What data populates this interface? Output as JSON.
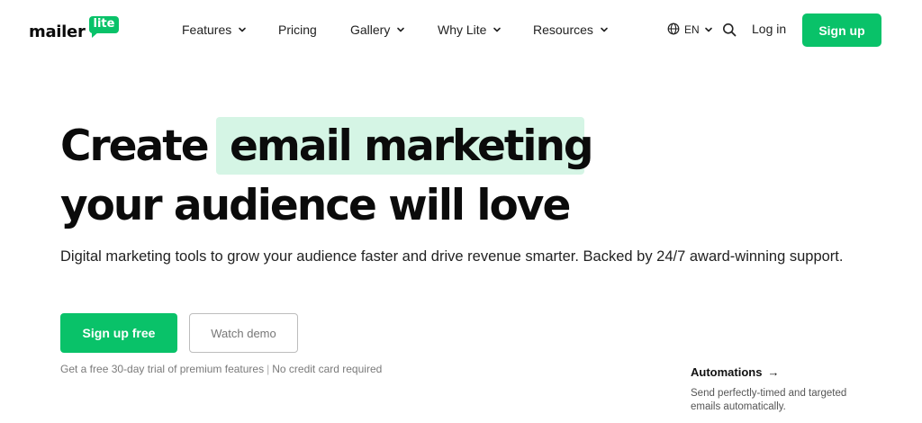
{
  "brand": {
    "logo_word": "mailer",
    "logo_badge": "lite",
    "accent_color": "#09c269",
    "highlight_color": "#d5f5e5"
  },
  "nav": {
    "items": [
      {
        "label": "Features",
        "has_dropdown": true
      },
      {
        "label": "Pricing",
        "has_dropdown": false
      },
      {
        "label": "Gallery",
        "has_dropdown": true
      },
      {
        "label": "Why Lite",
        "has_dropdown": true
      },
      {
        "label": "Resources",
        "has_dropdown": true
      }
    ],
    "language": {
      "icon": "globe-icon",
      "label": "EN"
    },
    "search_icon": "search-icon",
    "login_label": "Log in",
    "signup_label": "Sign up"
  },
  "hero": {
    "headline_prefix": "Create",
    "headline_highlight": "email marketing",
    "headline_line2": "your audience will love",
    "subtext": "Digital marketing tools to grow your audience faster and drive revenue smarter. Backed by 24/7 award-winning support.",
    "primary_cta": "Sign up free",
    "secondary_cta": "Watch demo",
    "fineprint_left": "Get a free 30-day trial of premium features",
    "fineprint_sep": "|",
    "fineprint_right": "No credit card required"
  },
  "feature_card": {
    "title": "Automations",
    "arrow": "→",
    "description": "Send perfectly-timed and targeted emails automatically."
  }
}
